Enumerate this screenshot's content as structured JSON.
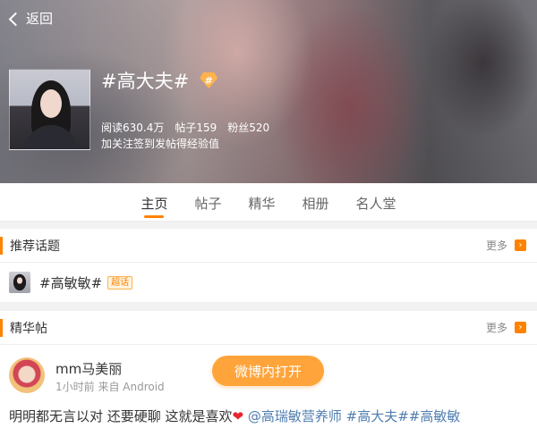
{
  "header": {
    "back_label": "返回",
    "topic_title": "#高大夫#",
    "super_badge": "#",
    "stats": {
      "read": "阅读630.4万",
      "posts": "帖子159",
      "fans": "粉丝520"
    },
    "subtitle": "加关注签到发帖得经验值"
  },
  "tabs": [
    {
      "label": "主页",
      "active": true
    },
    {
      "label": "帖子",
      "active": false
    },
    {
      "label": "精华",
      "active": false
    },
    {
      "label": "相册",
      "active": false
    },
    {
      "label": "名人堂",
      "active": false
    }
  ],
  "recommended": {
    "title": "推荐话题",
    "more_label": "更多",
    "item": {
      "name": "#高敏敏#",
      "badge": "超话"
    }
  },
  "featured": {
    "title": "精华帖",
    "more_label": "更多",
    "post": {
      "author": "mm马美丽",
      "meta": "1小时前 来自 Android",
      "text_prefix": "明明都无言以对 还要硬聊 这就是喜欢",
      "heart": "❤",
      "links": "@高瑞敏营养师 #高大夫##高敏敏"
    }
  },
  "open_button_label": "微博内打开",
  "colors": {
    "accent": "#ff8200",
    "button": "#ffa43a",
    "link": "#507daf"
  }
}
